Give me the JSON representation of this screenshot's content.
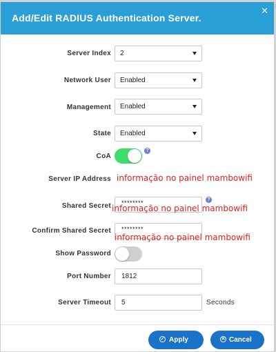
{
  "dialog": {
    "title": "Add/Edit RADIUS Authentication Server."
  },
  "fields": {
    "server_index": {
      "label": "Server Index",
      "value": "2"
    },
    "network_user": {
      "label": "Network User",
      "value": "Enabled"
    },
    "management": {
      "label": "Management",
      "value": "Enabled"
    },
    "state": {
      "label": "State",
      "value": "Enabled"
    },
    "coa": {
      "label": "CoA",
      "enabled": true
    },
    "server_ip": {
      "label": "Server IP Address",
      "overlay": "informação no painel mambowifi"
    },
    "shared_secret": {
      "label": "Shared Secret",
      "value": "********",
      "overlay": "informação no painel mambowifi"
    },
    "confirm_shared_secret": {
      "label": "Confirm Shared Secret",
      "value": "********",
      "overlay": "informação no painel mambowifi"
    },
    "show_password": {
      "label": "Show Password",
      "enabled": false
    },
    "port_number": {
      "label": "Port Number",
      "value": "1812"
    },
    "server_timeout": {
      "label": "Server Timeout",
      "value": "5",
      "suffix": "Seconds"
    }
  },
  "buttons": {
    "apply": "Apply",
    "cancel": "Cancel"
  },
  "colors": {
    "header": "#2a9fd6",
    "toggle_on": "#3ddc6b",
    "button": "#1a73c9",
    "overlay_text": "#e0201b"
  },
  "icons": {
    "close": "close-icon",
    "help": "help-icon",
    "apply": "check-circle-icon",
    "cancel": "x-circle-icon"
  }
}
